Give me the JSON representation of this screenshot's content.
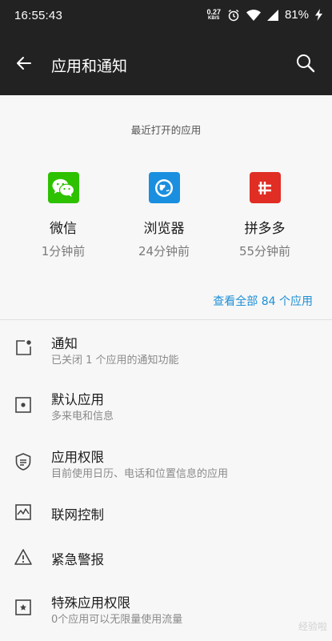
{
  "status": {
    "time": "16:55:43",
    "net_speed": "0.27",
    "net_unit": "KB/S",
    "battery": "81%"
  },
  "header": {
    "title": "应用和通知",
    "back_icon": "arrow-left-icon",
    "search_icon": "search-icon"
  },
  "recent": {
    "title": "最近打开的应用",
    "apps": [
      {
        "name": "微信",
        "time": "1分钟前",
        "icon": "wechat-icon",
        "color": "#2dc100"
      },
      {
        "name": "浏览器",
        "time": "24分钟前",
        "icon": "browser-icon",
        "color": "#1a8fe0"
      },
      {
        "name": "拼多多",
        "time": "55分钟前",
        "icon": "pinduoduo-icon",
        "color": "#e02e24"
      }
    ],
    "view_all": "查看全部 84 个应用"
  },
  "settings": [
    {
      "title": "通知",
      "subtitle": "已关闭 1 个应用的通知功能",
      "icon": "notification-icon"
    },
    {
      "title": "默认应用",
      "subtitle": "多来电和信息",
      "icon": "default-app-icon"
    },
    {
      "title": "应用权限",
      "subtitle": "目前使用日历、电话和位置信息的应用",
      "icon": "shield-icon"
    },
    {
      "title": "联网控制",
      "subtitle": "",
      "icon": "network-control-icon"
    },
    {
      "title": "紧急警报",
      "subtitle": "",
      "icon": "warning-icon"
    },
    {
      "title": "特殊应用权限",
      "subtitle": "0个应用可以无限量使用流量",
      "icon": "star-box-icon"
    }
  ],
  "watermark": "经验啦"
}
